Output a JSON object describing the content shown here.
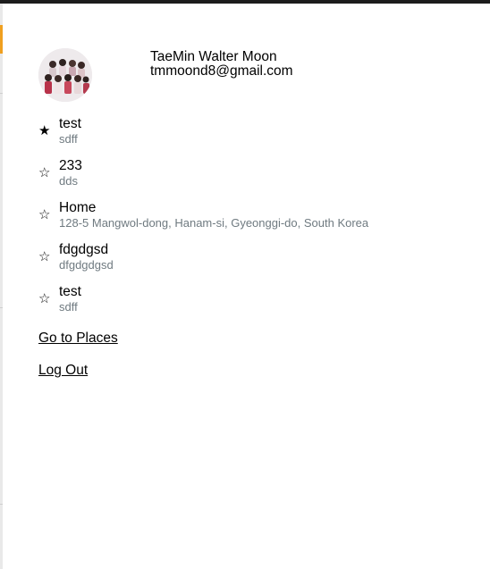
{
  "user": {
    "name": "TaeMin Walter Moon",
    "email": "tmmoond8@gmail.com"
  },
  "places": [
    {
      "name": "test",
      "address": "sdff",
      "starred": true,
      "icon": "filled-star-icon"
    },
    {
      "name": "233",
      "address": "dds",
      "starred": false,
      "icon": "outline-star-icon"
    },
    {
      "name": "Home",
      "address": "128-5 Mangwol-dong, Hanam-si, Gyeonggi-do, South Korea",
      "starred": false,
      "icon": "outline-star-icon"
    },
    {
      "name": "fdgdgsd",
      "address": "dfgdgdgsd",
      "starred": false,
      "icon": "outline-star-icon"
    },
    {
      "name": "test",
      "address": "sdff",
      "starred": false,
      "icon": "outline-star-icon"
    }
  ],
  "links": {
    "places": "Go to Places",
    "logout": "Log Out"
  },
  "colors": {
    "address_text": "#6f7a80",
    "top_bar": "#1c1c1c",
    "accent": "#f0a020"
  }
}
